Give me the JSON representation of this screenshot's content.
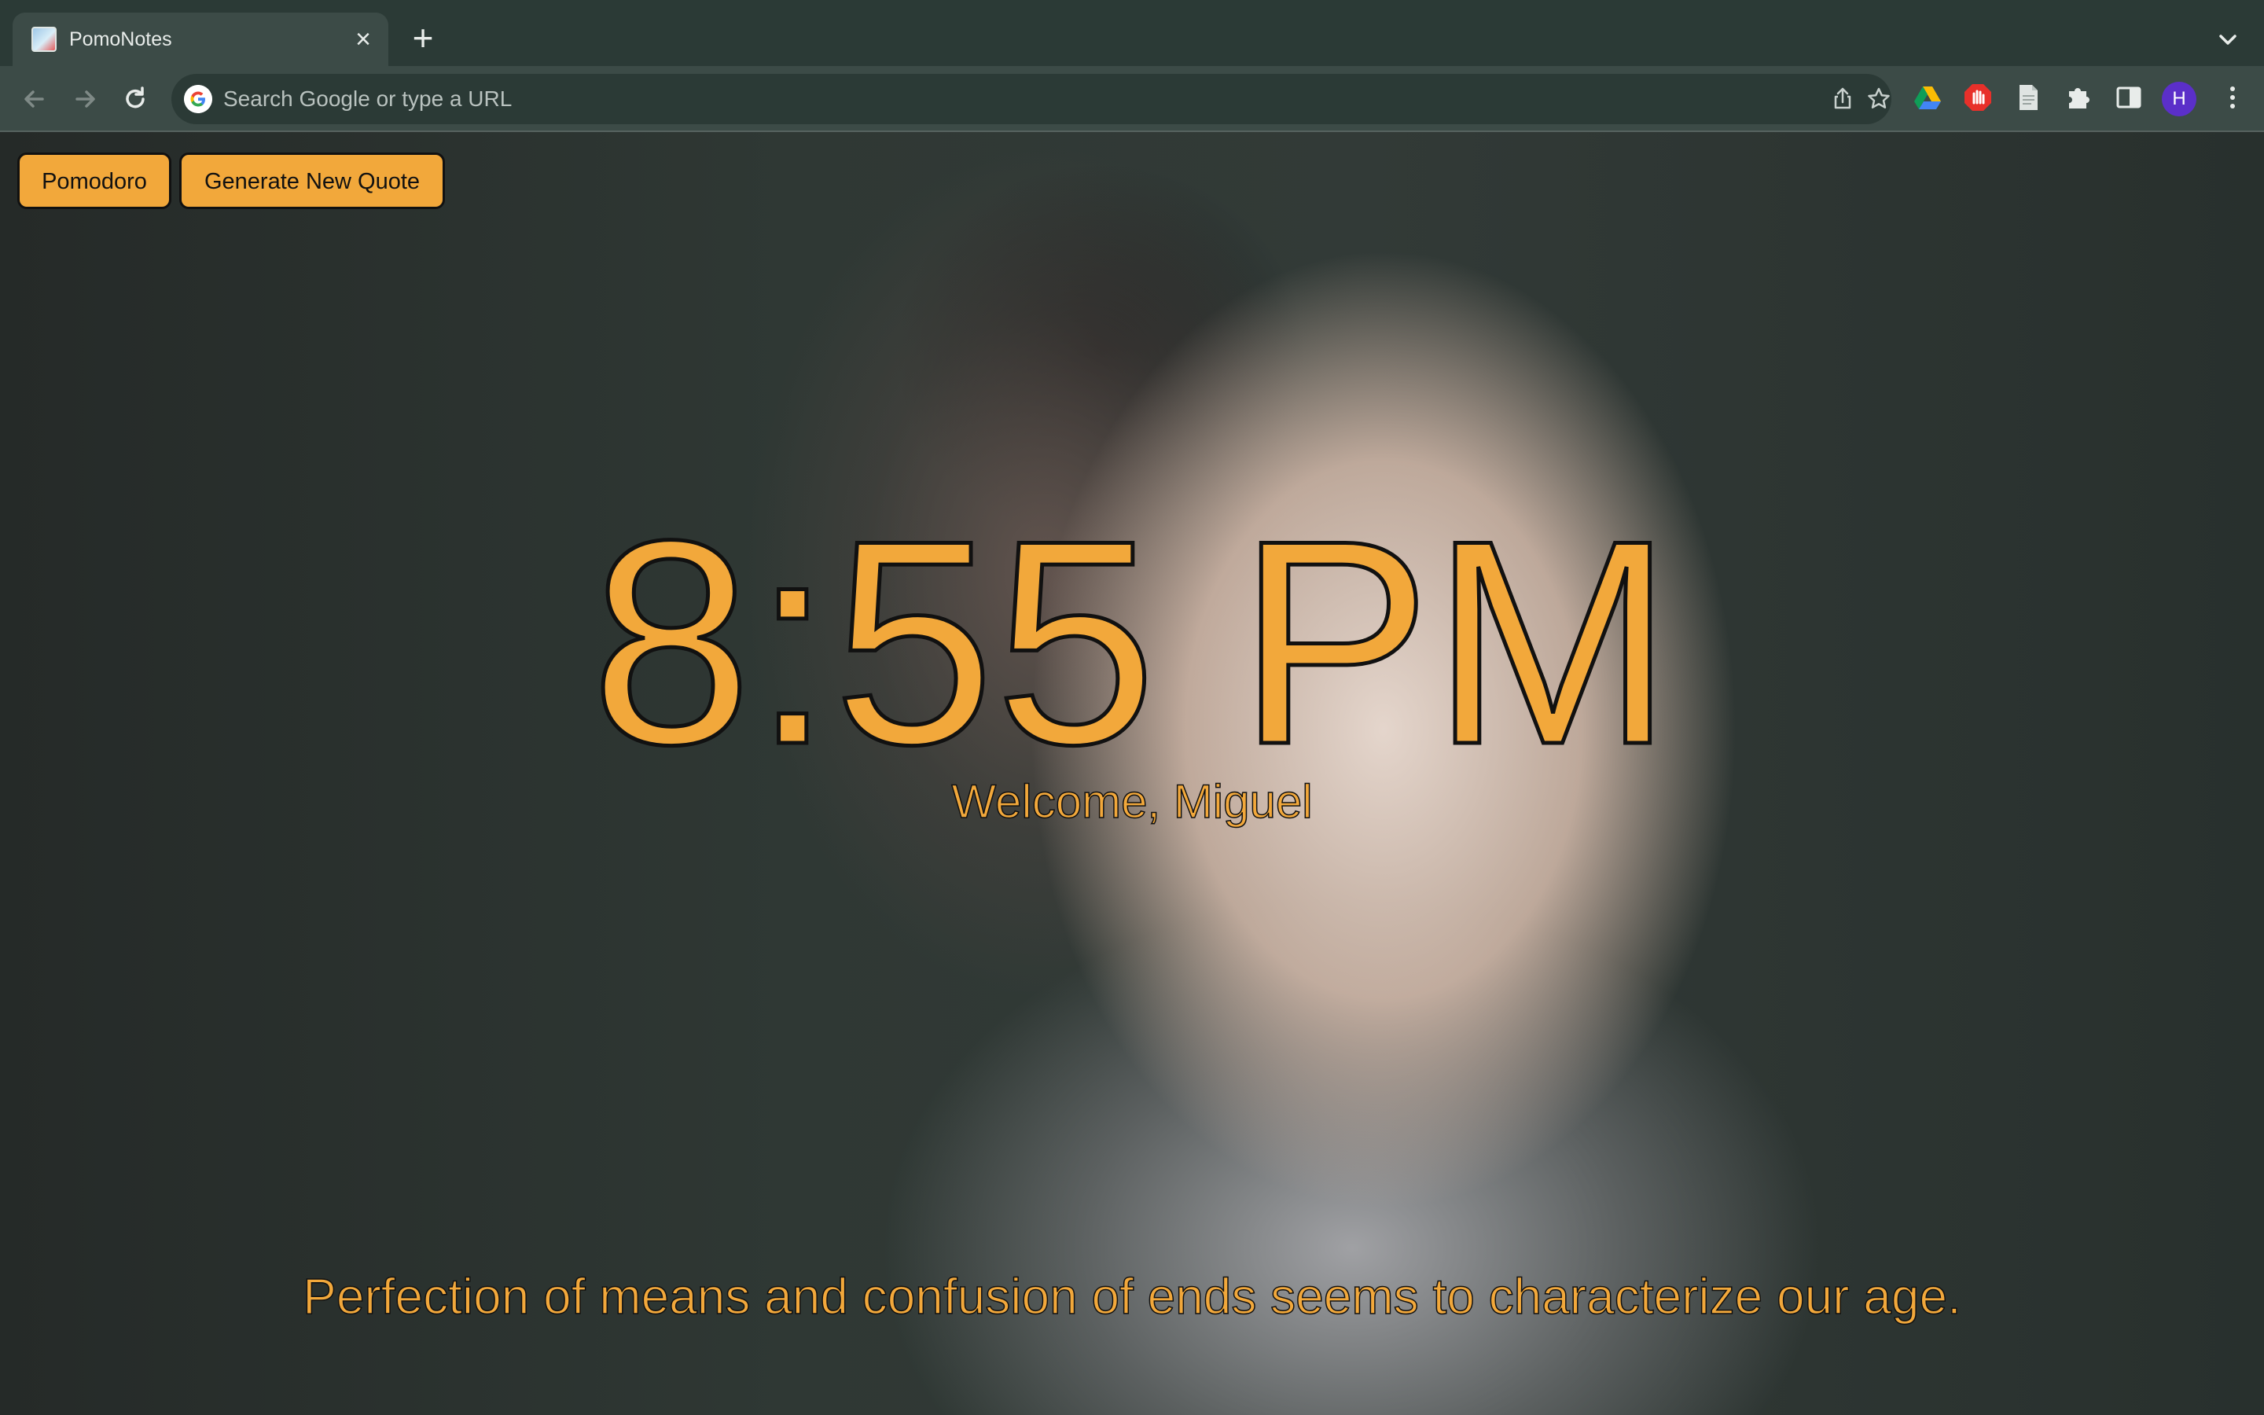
{
  "browser": {
    "tab": {
      "title": "PomoNotes",
      "favicon": "page-favicon",
      "close_icon": "close-icon"
    },
    "new_tab_icon": "plus-icon",
    "tab_search_icon": "chevron-down-icon",
    "toolbar": {
      "back_icon": "arrow-left-icon",
      "forward_icon": "arrow-right-icon",
      "reload_icon": "reload-icon",
      "omnibox": {
        "placeholder": "Search Google or type a URL",
        "value": "",
        "google_icon": "google-g-icon",
        "share_icon": "share-icon",
        "bookmark_icon": "star-icon"
      },
      "extensions": [
        {
          "name": "google-drive-icon"
        },
        {
          "name": "adblock-icon"
        },
        {
          "name": "document-icon"
        },
        {
          "name": "puzzle-icon"
        },
        {
          "name": "side-panel-icon"
        }
      ],
      "profile_initial": "H",
      "menu_icon": "kebab-menu-icon"
    }
  },
  "app": {
    "buttons": {
      "pomodoro_label": "Pomodoro",
      "new_quote_label": "Generate New Quote"
    },
    "clock": "8:55 PM",
    "welcome": "Welcome, Miguel",
    "quote": "Perfection of means and confusion of ends seems to characterize our age.",
    "background": "photo-fist-blurred-person"
  },
  "colors": {
    "accent": "#f2a83b",
    "outline": "#111111",
    "chrome_dark": "#2b3a36",
    "chrome_light": "#3c4b47",
    "avatar": "#5b2fc9"
  }
}
